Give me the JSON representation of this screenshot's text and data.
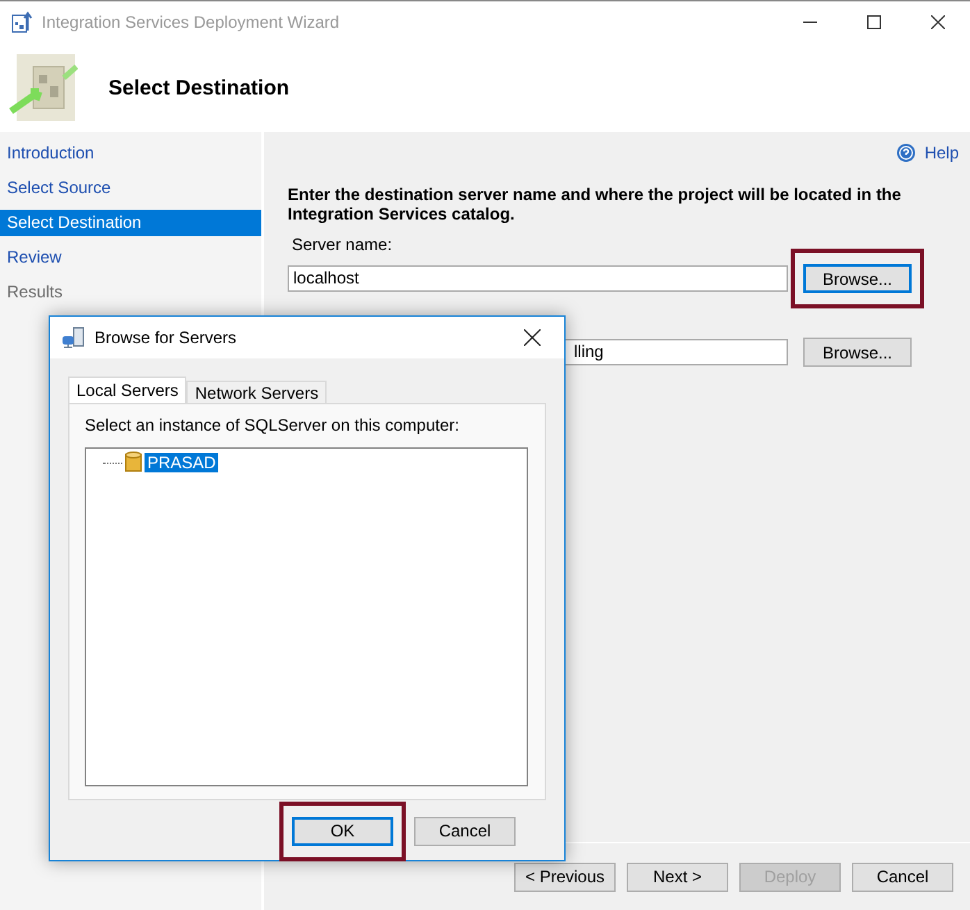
{
  "window": {
    "title": "Integration Services Deployment Wizard"
  },
  "header": {
    "title": "Select Destination"
  },
  "sidebar": {
    "items": [
      {
        "label": "Introduction",
        "selected": false,
        "disabled": false
      },
      {
        "label": "Select Source",
        "selected": false,
        "disabled": false
      },
      {
        "label": "Select Destination",
        "selected": true,
        "disabled": false
      },
      {
        "label": "Review",
        "selected": false,
        "disabled": false
      },
      {
        "label": "Results",
        "selected": false,
        "disabled": true
      }
    ]
  },
  "help": {
    "label": "Help"
  },
  "content": {
    "instruction": "Enter the destination server name and where the project will be located in the Integration Services catalog.",
    "fields": [
      {
        "label": "Server name:",
        "value": "localhost",
        "button": "Browse...",
        "highlighted": true
      },
      {
        "value": "lling",
        "button": "Browse...",
        "highlighted": false
      }
    ]
  },
  "footer": {
    "buttons": [
      {
        "label": "< Previous",
        "disabled": false
      },
      {
        "label": "Next >",
        "disabled": false
      },
      {
        "label": "Deploy",
        "disabled": true
      },
      {
        "label": "Cancel",
        "disabled": false
      }
    ]
  },
  "dialog": {
    "title": "Browse for Servers",
    "tabs": [
      {
        "label": "Local Servers",
        "selected": true
      },
      {
        "label": "Network Servers",
        "selected": false
      }
    ],
    "prompt": "Select an instance of SQLServer on this computer:",
    "tree": [
      {
        "label": "PRASAD",
        "selected": true
      }
    ],
    "buttons": [
      {
        "label": "OK",
        "highlighted": true,
        "default": true
      },
      {
        "label": "Cancel",
        "highlighted": false,
        "default": false
      }
    ]
  }
}
